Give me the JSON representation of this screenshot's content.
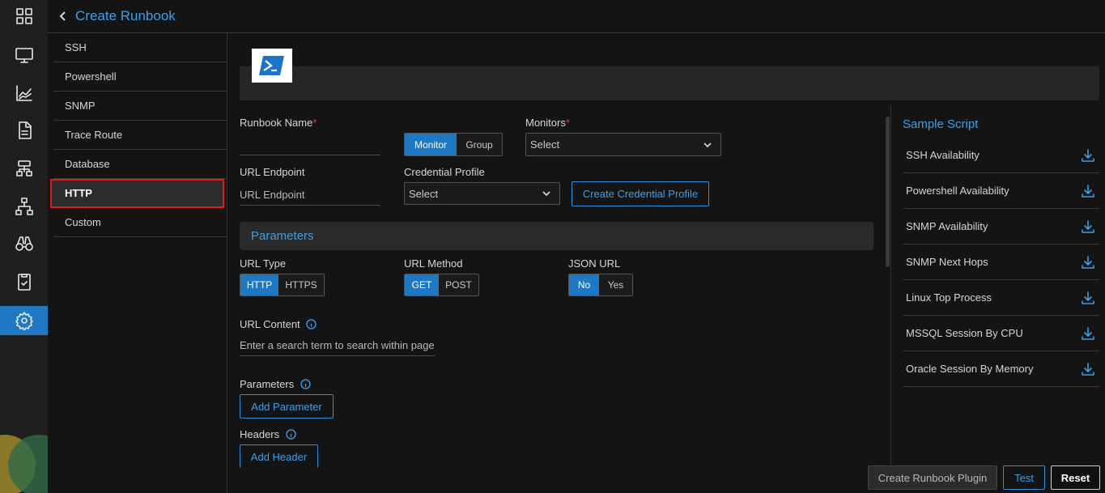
{
  "header": {
    "title": "Create Runbook"
  },
  "rail": {
    "icons": [
      "dashboard-icon",
      "monitor-icon",
      "metrics-icon",
      "report-icon",
      "topology-icon",
      "network-icon",
      "explorer-icon",
      "audit-icon",
      "settings-icon"
    ],
    "active": "settings-icon",
    "accent": "#1f78c4"
  },
  "types": {
    "items": [
      "SSH",
      "Powershell",
      "SNMP",
      "Trace Route",
      "Database",
      "HTTP",
      "Custom"
    ],
    "selected": "HTTP"
  },
  "form": {
    "runbook_name": {
      "label": "Runbook Name",
      "required_mark": "*",
      "value": ""
    },
    "target_toggle": {
      "options": [
        "Monitor",
        "Group"
      ],
      "selected": "Monitor"
    },
    "monitors": {
      "label": "Monitors",
      "required_mark": "*",
      "value": "Select"
    },
    "url_endpoint": {
      "label": "URL Endpoint",
      "placeholder": "URL Endpoint"
    },
    "credential_profile": {
      "label": "Credential Profile",
      "value": "Select"
    },
    "create_credential_button": "Create Credential Profile"
  },
  "parameters_section": {
    "title": "Parameters",
    "url_type": {
      "label": "URL Type",
      "options": [
        "HTTP",
        "HTTPS"
      ],
      "selected": "HTTP"
    },
    "url_method": {
      "label": "URL Method",
      "options": [
        "GET",
        "POST"
      ],
      "selected": "GET"
    },
    "json_url": {
      "label": "JSON URL",
      "options": [
        "No",
        "Yes"
      ],
      "selected": "No"
    },
    "url_content": {
      "label": "URL Content",
      "placeholder": "Enter a search term to search within page"
    },
    "parameters": {
      "label": "Parameters",
      "button": "Add Parameter"
    },
    "headers": {
      "label": "Headers",
      "button": "Add Header"
    }
  },
  "sample_script": {
    "title": "Sample Script",
    "items": [
      "SSH Availability",
      "Powershell Availability",
      "SNMP Availability",
      "SNMP Next Hops",
      "Linux Top Process",
      "MSSQL Session By CPU",
      "Oracle Session By Memory"
    ]
  },
  "actions": {
    "create_plugin": "Create Runbook Plugin",
    "test": "Test",
    "reset": "Reset"
  }
}
